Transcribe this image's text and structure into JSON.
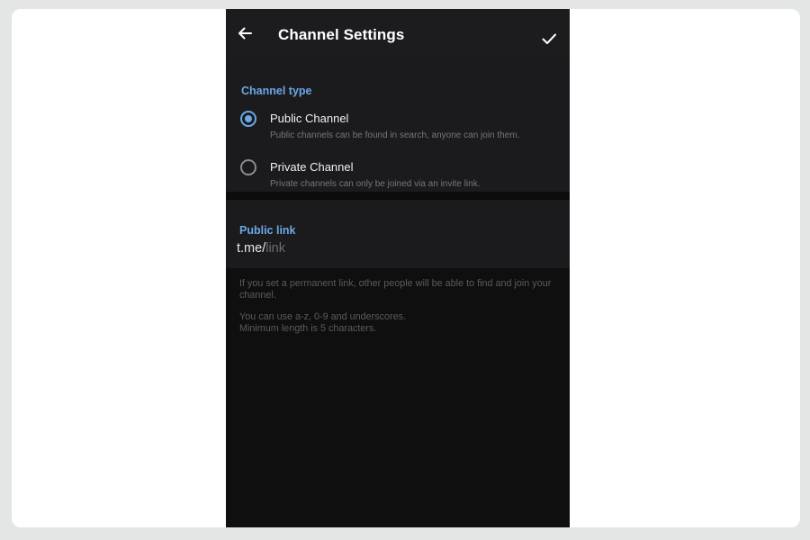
{
  "header": {
    "title": "Channel Settings"
  },
  "channel_type": {
    "section_title": "Channel type",
    "options": [
      {
        "label": "Public Channel",
        "description": "Public channels can be found in search, anyone can join them.",
        "selected": true
      },
      {
        "label": "Private Channel",
        "description": "Private channels can only be joined via an invite link.",
        "selected": false
      }
    ]
  },
  "public_link": {
    "section_title": "Public link",
    "prefix": "t.me/",
    "placeholder": "link",
    "help_1": "If you set a permanent link, other people will be able to find and join your channel.",
    "help_2_line1": "You can use a-z, 0-9 and underscores.",
    "help_2_line2": "Minimum length is 5 characters."
  },
  "colors": {
    "accent": "#6aa8e6",
    "background": "#0f0f10",
    "surface": "#1b1b1d"
  }
}
